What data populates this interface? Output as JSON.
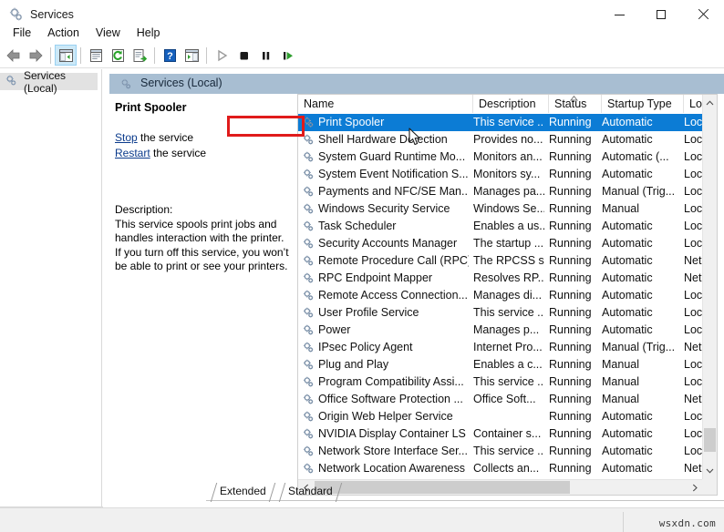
{
  "window": {
    "title": "Services",
    "app_icon": "gears-icon",
    "controls": {
      "minimize": "minimize-icon",
      "maximize": "maximize-icon",
      "close": "close-icon"
    }
  },
  "menubar": {
    "items": [
      {
        "label": "File"
      },
      {
        "label": "Action"
      },
      {
        "label": "View"
      },
      {
        "label": "Help"
      }
    ]
  },
  "toolbar": {
    "buttons": [
      {
        "name": "back-arrow-icon",
        "tip": "Back"
      },
      {
        "name": "forward-arrow-icon",
        "tip": "Forward"
      },
      {
        "name": "show-hide-console-tree-icon",
        "tip": "Show/Hide Console Tree",
        "active": true
      },
      {
        "name": "properties-icon",
        "tip": "Properties"
      },
      {
        "name": "refresh-icon",
        "tip": "Refresh"
      },
      {
        "name": "export-list-icon",
        "tip": "Export List"
      },
      {
        "name": "help-icon",
        "tip": "Help"
      },
      {
        "name": "show-action-pane-icon",
        "tip": "Show/Hide Action Pane"
      },
      {
        "name": "start-service-icon",
        "tip": "Start Service"
      },
      {
        "name": "stop-service-icon",
        "tip": "Stop Service"
      },
      {
        "name": "pause-service-icon",
        "tip": "Pause Service"
      },
      {
        "name": "restart-service-icon",
        "tip": "Restart Service"
      }
    ]
  },
  "tree": {
    "root_label": "Services (Local)",
    "root_icon": "gears-icon"
  },
  "pane": {
    "header_label": "Services (Local)",
    "header_icon": "gears-icon"
  },
  "details": {
    "service_title": "Print Spooler",
    "stop_link": "Stop",
    "stop_suffix": " the service",
    "restart_link": "Restart",
    "restart_suffix": " the service",
    "description_label": "Description:",
    "description_text": "This service spools print jobs and handles interaction with the printer. If you turn off this service, you won’t be able to print or see your printers."
  },
  "list": {
    "columns": [
      {
        "key": "name",
        "label": "Name"
      },
      {
        "key": "description",
        "label": "Description"
      },
      {
        "key": "status",
        "label": "Status",
        "sorted": "asc"
      },
      {
        "key": "startup",
        "label": "Startup Type"
      },
      {
        "key": "logon",
        "label": "Log"
      }
    ],
    "rows": [
      {
        "icon": "service-gears-icon",
        "name": "Print Spooler",
        "description": "This service ...",
        "status": "Running",
        "startup": "Automatic",
        "logon": "Loc",
        "selected": true
      },
      {
        "icon": "service-gears-icon",
        "name": "Shell Hardware Detection",
        "description": "Provides no...",
        "status": "Running",
        "startup": "Automatic",
        "logon": "Loc",
        "selected": false
      },
      {
        "icon": "service-gears-icon",
        "name": "System Guard Runtime Mo...",
        "description": "Monitors an...",
        "status": "Running",
        "startup": "Automatic (...",
        "logon": "Loc",
        "selected": false
      },
      {
        "icon": "service-gears-icon",
        "name": "System Event Notification S...",
        "description": "Monitors sy...",
        "status": "Running",
        "startup": "Automatic",
        "logon": "Loc",
        "selected": false
      },
      {
        "icon": "service-gears-icon",
        "name": "Payments and NFC/SE Man...",
        "description": "Manages pa...",
        "status": "Running",
        "startup": "Manual (Trig...",
        "logon": "Loc",
        "selected": false
      },
      {
        "icon": "service-gears-icon",
        "name": "Windows Security Service",
        "description": "Windows Se...",
        "status": "Running",
        "startup": "Manual",
        "logon": "Loc",
        "selected": false
      },
      {
        "icon": "service-gears-icon",
        "name": "Task Scheduler",
        "description": "Enables a us...",
        "status": "Running",
        "startup": "Automatic",
        "logon": "Loc",
        "selected": false
      },
      {
        "icon": "service-gears-icon",
        "name": "Security Accounts Manager",
        "description": "The startup ...",
        "status": "Running",
        "startup": "Automatic",
        "logon": "Loc",
        "selected": false
      },
      {
        "icon": "service-gears-icon",
        "name": "Remote Procedure Call (RPC)",
        "description": "The RPCSS s...",
        "status": "Running",
        "startup": "Automatic",
        "logon": "Net",
        "selected": false
      },
      {
        "icon": "service-gears-icon",
        "name": "RPC Endpoint Mapper",
        "description": "Resolves RP...",
        "status": "Running",
        "startup": "Automatic",
        "logon": "Net",
        "selected": false
      },
      {
        "icon": "service-gears-icon",
        "name": "Remote Access Connection...",
        "description": "Manages di...",
        "status": "Running",
        "startup": "Automatic",
        "logon": "Loc",
        "selected": false
      },
      {
        "icon": "service-gears-icon",
        "name": "User Profile Service",
        "description": "This service ...",
        "status": "Running",
        "startup": "Automatic",
        "logon": "Loc",
        "selected": false
      },
      {
        "icon": "service-gears-icon",
        "name": "Power",
        "description": "Manages p...",
        "status": "Running",
        "startup": "Automatic",
        "logon": "Loc",
        "selected": false
      },
      {
        "icon": "service-gears-icon",
        "name": "IPsec Policy Agent",
        "description": "Internet Pro...",
        "status": "Running",
        "startup": "Manual (Trig...",
        "logon": "Net",
        "selected": false
      },
      {
        "icon": "service-gears-icon",
        "name": "Plug and Play",
        "description": "Enables a c...",
        "status": "Running",
        "startup": "Manual",
        "logon": "Loc",
        "selected": false
      },
      {
        "icon": "service-gears-icon",
        "name": "Program Compatibility Assi...",
        "description": "This service ...",
        "status": "Running",
        "startup": "Manual",
        "logon": "Loc",
        "selected": false
      },
      {
        "icon": "service-gears-icon",
        "name": "Office Software Protection ...",
        "description": "Office Soft...",
        "status": "Running",
        "startup": "Manual",
        "logon": "Net",
        "selected": false
      },
      {
        "icon": "service-gears-icon",
        "name": "Origin Web Helper Service",
        "description": "",
        "status": "Running",
        "startup": "Automatic",
        "logon": "Loc",
        "selected": false
      },
      {
        "icon": "service-gears-icon",
        "name": "NVIDIA Display Container LS",
        "description": "Container s...",
        "status": "Running",
        "startup": "Automatic",
        "logon": "Loc",
        "selected": false
      },
      {
        "icon": "service-gears-icon",
        "name": "Network Store Interface Ser...",
        "description": "This service ...",
        "status": "Running",
        "startup": "Automatic",
        "logon": "Loc",
        "selected": false
      },
      {
        "icon": "service-gears-icon",
        "name": "Network Location Awareness",
        "description": "Collects an...",
        "status": "Running",
        "startup": "Automatic",
        "logon": "Net",
        "selected": false
      }
    ]
  },
  "scrollbars": {
    "vertical_up": "▲",
    "vertical_down": "▼",
    "horizontal_left": "◄",
    "horizontal_right": "►"
  },
  "tabs": [
    {
      "label": "Extended",
      "active": false
    },
    {
      "label": "Standard",
      "active": true
    }
  ],
  "annotation": {
    "color": "#e01b1b",
    "target": "Print Spooler"
  },
  "statusbar": {
    "watermark": "wsxdn.com"
  },
  "colors": {
    "selection_blue": "#0c7cd5",
    "pane_header": "#a8bed2",
    "link_blue": "#0b3b8c",
    "annotation_red": "#e01b1b"
  }
}
